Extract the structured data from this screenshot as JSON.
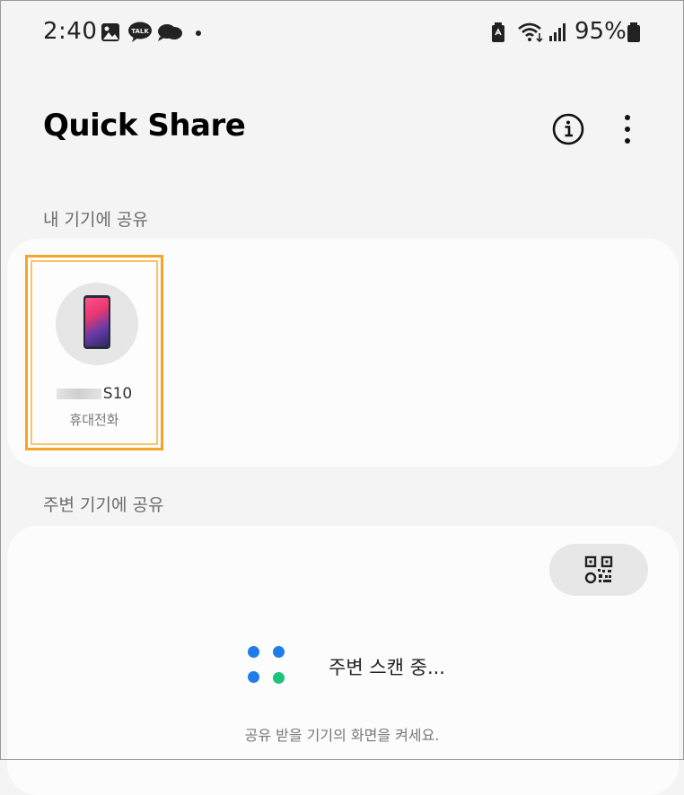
{
  "status_bar": {
    "time": "2:40",
    "battery_percent": "95%",
    "notification_icons": [
      "gallery-icon",
      "kakaotalk-icon",
      "chat-bubble-icon",
      "dot-icon"
    ],
    "system_icons": [
      "battery-saver-icon",
      "wifi-icon",
      "signal-icon",
      "battery-icon"
    ]
  },
  "header": {
    "title": "Quick Share",
    "info_button_icon": "info-icon",
    "more_button_icon": "more-vert-icon"
  },
  "my_devices": {
    "label": "내 기기에 공유",
    "devices": [
      {
        "name": "S10",
        "type": "휴대전화",
        "icon": "smartphone-icon"
      }
    ]
  },
  "nearby": {
    "label": "주변 기기에 공유",
    "qr_button_icon": "qr-code-icon",
    "scanning_text": "주변 스캔 중...",
    "hint": "공유 받을 기기의 화면을 켜세요."
  },
  "colors": {
    "highlight_border": "#f4a52a",
    "scan_dot_blue": "#1f7ce8",
    "scan_dot_green": "#1fc27a"
  }
}
